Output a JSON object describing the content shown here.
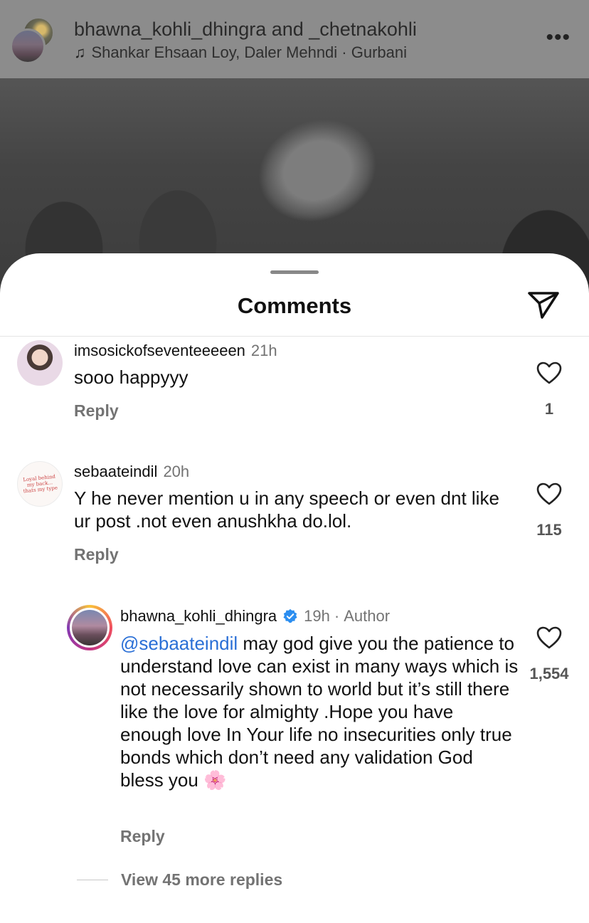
{
  "post": {
    "users_line": "bhawna_kohli_dhingra and _chetnakohli",
    "music_line": "Shankar Ehsaan Loy, Daler Mehndi · Gurbani",
    "music_icon": "music-note-icon",
    "more_icon": "more-horizontal-icon",
    "more_glyph": "•••"
  },
  "sheet": {
    "title": "Comments",
    "share_icon": "send-icon"
  },
  "comments": [
    {
      "username": "imsosickofseventeeeeen",
      "time": "21h",
      "text": "sooo happyyy",
      "reply_label": "Reply",
      "likes": "1"
    },
    {
      "username": "sebaateindil",
      "time": "20h",
      "text": "Y he never mention u in any speech or even dnt like ur post .not even anushkha do.lol.",
      "reply_label": "Reply",
      "likes": "115",
      "avatar_text": "Loyal behind my back... thats my type"
    }
  ],
  "reply": {
    "username": "bhawna_kohli_dhingra",
    "verified": true,
    "time": "19h",
    "separator": "·",
    "author_label": "Author",
    "mention": "@sebaateindil",
    "text": " may god give you the patience to understand love can exist in many ways which is not necessarily shown to world but it’s still there like the love for almighty .Hope  you have enough love In Your life no insecurities only true bonds which don’t need any validation God bless you ",
    "emoji": "🌸",
    "reply_label": "Reply",
    "likes": "1,554"
  },
  "view_more_label": "View 45 more replies",
  "colors": {
    "mention": "#2a6fd6",
    "verified": "#2c8ef0",
    "muted_text": "#737373"
  }
}
